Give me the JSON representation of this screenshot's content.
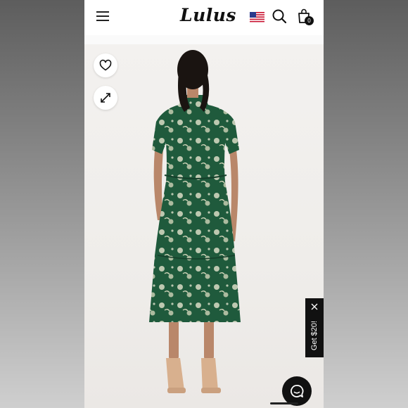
{
  "header": {
    "brand": "Lulus",
    "menu_icon": "hamburger-menu-icon",
    "flag_icon": "us-flag-icon",
    "search_icon": "search-icon",
    "bag_icon": "shopping-bag-icon",
    "bag_count": "0"
  },
  "product_image": {
    "wishlist_icon": "heart-icon",
    "expand_icon": "expand-icon",
    "colors": {
      "dress": "#1f5a3c",
      "floral": "#d9dcc4",
      "skin": "#b9876a",
      "hair": "#1a1411",
      "shoes": "#d8b08e"
    }
  },
  "promo": {
    "text": "Get $20!",
    "close_icon": "close-icon"
  },
  "chat": {
    "icon": "chat-bubble-icon"
  }
}
